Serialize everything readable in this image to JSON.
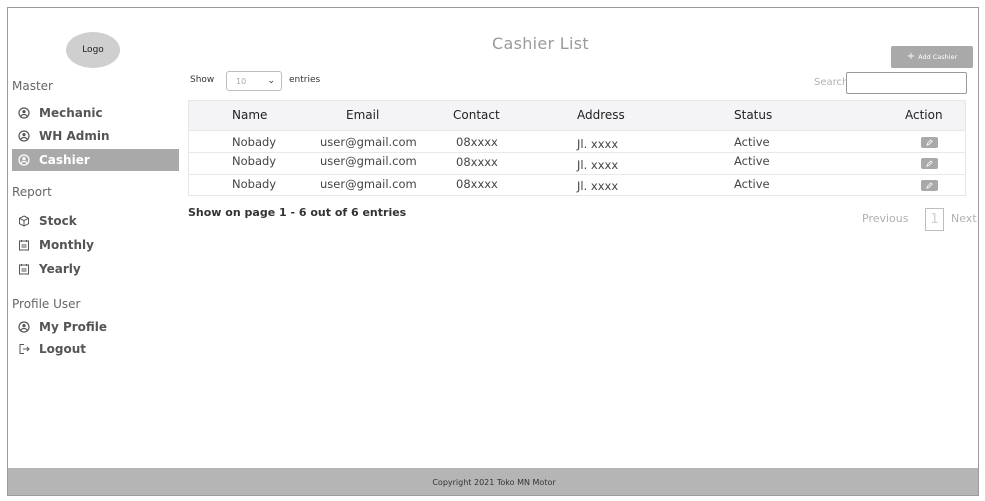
{
  "logo": {
    "text": "Logo"
  },
  "header": {
    "title": "Cashier List",
    "add_button": "Add Cashier"
  },
  "sidebar": {
    "sections": [
      {
        "title": "Master",
        "items": [
          {
            "label": "Mechanic",
            "icon": "user-circle-icon",
            "active": false
          },
          {
            "label": "WH Admin",
            "icon": "user-circle-icon",
            "active": false
          },
          {
            "label": "Cashier",
            "icon": "user-circle-icon",
            "active": true
          }
        ]
      },
      {
        "title": "Report",
        "items": [
          {
            "label": "Stock",
            "icon": "box-icon",
            "active": false
          },
          {
            "label": "Monthly",
            "icon": "calendar-icon",
            "active": false
          },
          {
            "label": "Yearly",
            "icon": "calendar-icon",
            "active": false
          }
        ]
      },
      {
        "title": "Profile User",
        "items": [
          {
            "label": "My Profile",
            "icon": "user-circle-icon",
            "active": false
          },
          {
            "label": "Logout",
            "icon": "logout-icon",
            "active": false
          }
        ]
      }
    ]
  },
  "controls": {
    "show_label": "Show",
    "length_value": "10",
    "entries_label": "entries",
    "search_label": "Search:",
    "search_value": ""
  },
  "table": {
    "columns": [
      "Name",
      "Email",
      "Contact",
      "Address",
      "Status",
      "Action"
    ],
    "rows": [
      [
        "Nobady",
        "user@gmail.com",
        "08xxxx",
        "Jl. xxxx",
        "Active"
      ],
      [
        "Nobady",
        "user@gmail.com",
        "08xxxx",
        "Jl. xxxx",
        "Active"
      ],
      [
        "Nobady",
        "user@gmail.com",
        "08xxxx",
        "Jl. xxxx",
        "Active"
      ]
    ]
  },
  "pagination": {
    "info": "Show on page 1 - 6 out of 6 entries",
    "previous": "Previous",
    "page": "1",
    "next": "Next"
  },
  "footer": {
    "text": "Copyright 2021 Toko MN Motor"
  },
  "colors": {
    "accent_gray": "#a9a9a9",
    "header_bg": "#f4f4f7",
    "footer_bg": "#b5b5b5"
  }
}
